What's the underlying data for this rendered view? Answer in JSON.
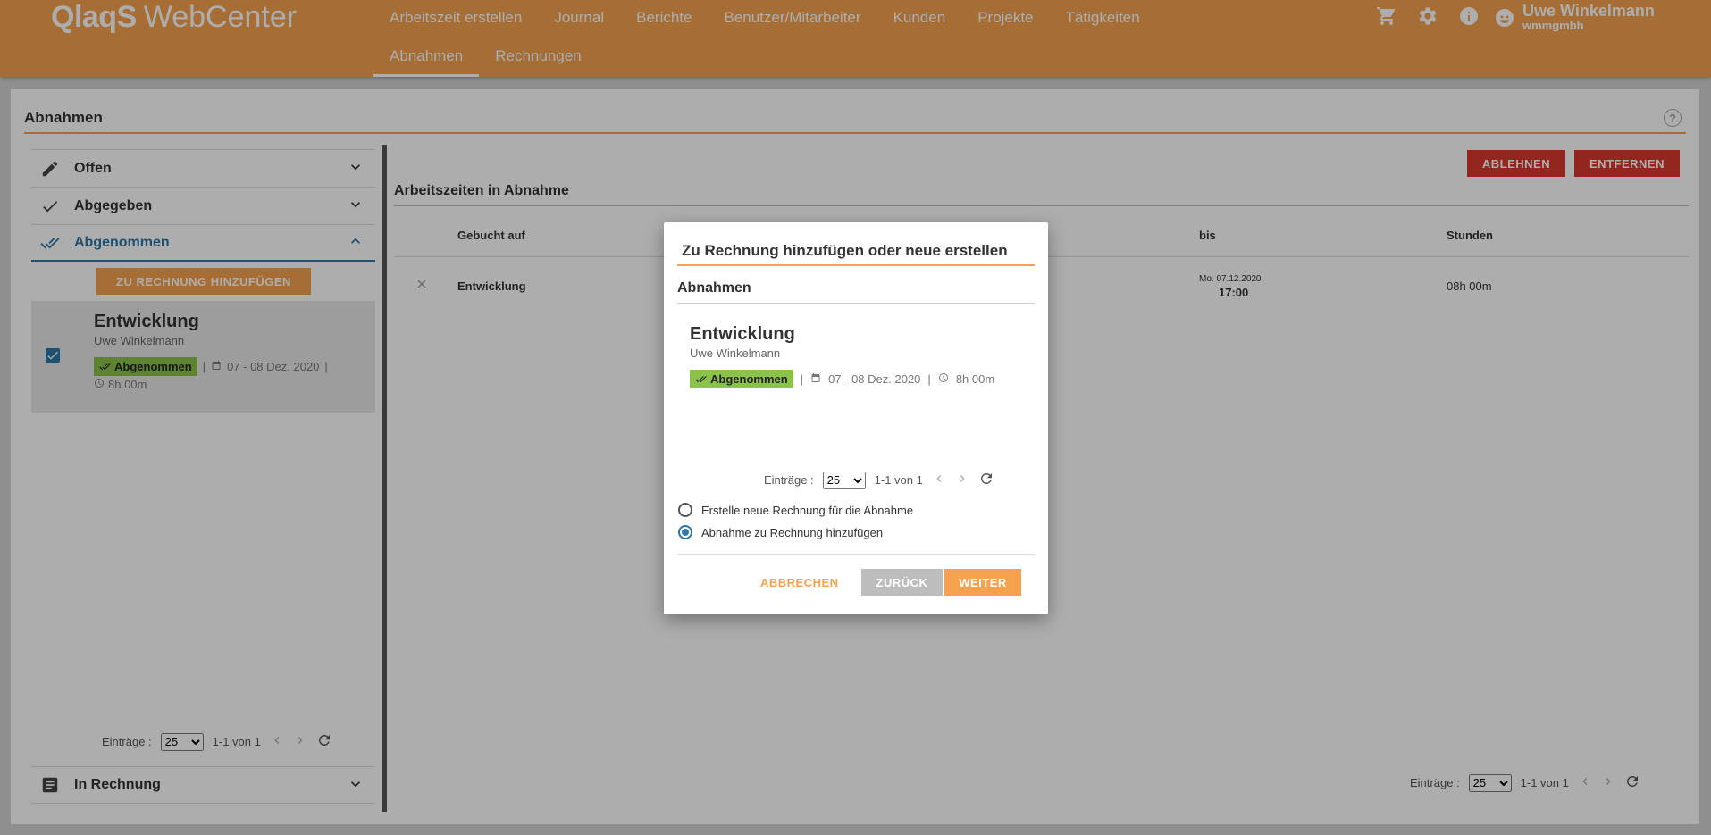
{
  "app": {
    "logo_q": "QlaqS",
    "logo_web": "WebCenter"
  },
  "nav": {
    "row1": [
      "Arbeitszeit erstellen",
      "Journal",
      "Berichte",
      "Benutzer/Mitarbeiter",
      "Kunden",
      "Projekte",
      "Tätigkeiten"
    ],
    "row2": [
      "Abnahmen",
      "Rechnungen"
    ],
    "active": "Abnahmen"
  },
  "user": {
    "name": "Uwe Winkelmann",
    "org": "wmmgmbh"
  },
  "icons": {
    "cart": "cart-icon",
    "settings": "gear-icon",
    "info": "info-icon",
    "avatar": "user-avatar-icon"
  },
  "page": {
    "title": "Abnahmen",
    "help": "?"
  },
  "sidebar": {
    "items": [
      {
        "label": "Offen",
        "icon": "pencil-icon"
      },
      {
        "label": "Abgegeben",
        "icon": "check-icon"
      },
      {
        "label": "Abgenommen",
        "icon": "double-check-icon"
      },
      {
        "label": "In Rechnung",
        "icon": "list-icon"
      }
    ],
    "add_invoice_button": "ZU RECHNUNG HINZUFÜGEN",
    "card": {
      "title": "Entwicklung",
      "user": "Uwe Winkelmann",
      "status": "Abgenommen",
      "date_range": "07 - 08 Dez. 2020",
      "duration": "8h 00m",
      "sep": "|"
    },
    "pager": {
      "label": "Einträge :",
      "page_size": "25",
      "range": "1-1 von 1"
    }
  },
  "content": {
    "reject_button": "ABLEHNEN",
    "remove_button": "ENTFERNEN",
    "section_title": "Arbeitszeiten in Abnahme",
    "columns": [
      "Gebucht auf",
      "bis",
      "Stunden"
    ],
    "row": {
      "booked_on": "Entwicklung",
      "until_date": "Mo. 07.12.2020",
      "until_time": "17:00",
      "hours": "08h 00m"
    },
    "pager": {
      "label": "Einträge :",
      "page_size": "25",
      "range": "1-1 von 1"
    }
  },
  "modal": {
    "title": "Zu Rechnung hinzufügen oder neue erstellen",
    "subtitle": "Abnahmen",
    "card": {
      "title": "Entwicklung",
      "user": "Uwe Winkelmann",
      "status": "Abgenommen",
      "date_range": "07 - 08 Dez. 2020",
      "duration": "8h 00m",
      "sep": "|"
    },
    "pager": {
      "label": "Einträge :",
      "page_size": "25",
      "range": "1-1 von 1"
    },
    "options": [
      {
        "label": "Erstelle neue Rechnung für die Abnahme",
        "checked": false
      },
      {
        "label": "Abnahme zu Rechnung hinzufügen",
        "checked": true
      }
    ],
    "cancel_button": "ABBRECHEN",
    "back_button": "ZURÜCK",
    "next_button": "WEITER"
  },
  "colors": {
    "brand": "#f5a24f",
    "accent_blue": "#2e77a8",
    "danger": "#d93a2f",
    "success": "#8bc34a"
  }
}
